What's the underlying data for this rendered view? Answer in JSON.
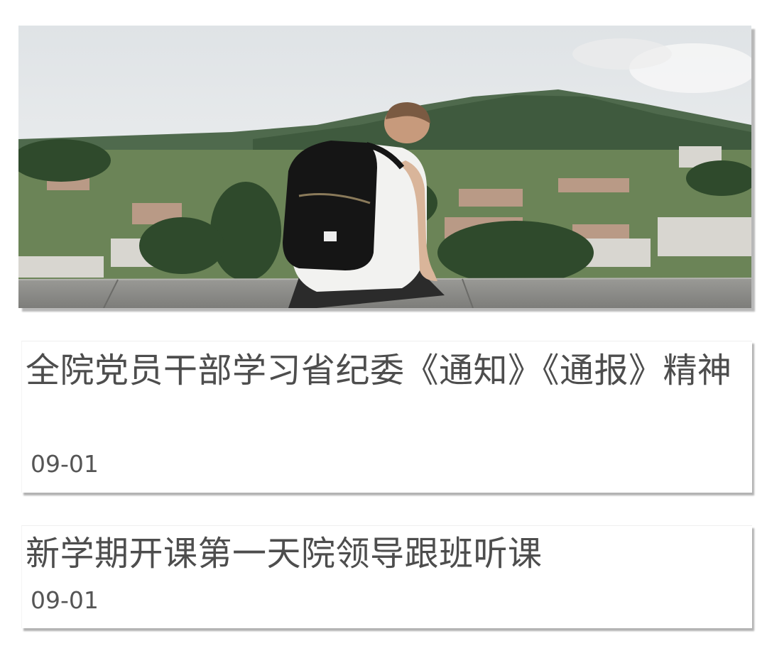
{
  "banner": {
    "image_description_icon": "photo-hiker-overlooking-town"
  },
  "news": [
    {
      "title": "全院党员干部学习省纪委《通知》《通报》精神",
      "date": "09-01"
    },
    {
      "title": "新学期开课第一天院领导跟班听课",
      "date": "09-01"
    }
  ],
  "colors": {
    "text": "#4d4d4d",
    "date": "#555555",
    "background": "#ffffff"
  }
}
